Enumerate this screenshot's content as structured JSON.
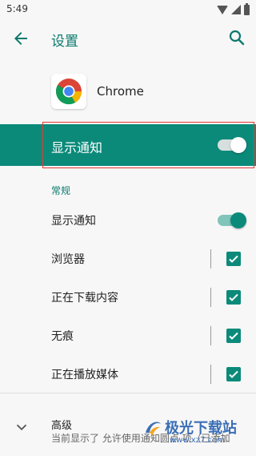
{
  "status_bar": {
    "time": "5:49"
  },
  "header": {
    "title": "设置"
  },
  "app": {
    "name": "Chrome"
  },
  "master_toggle": {
    "label": "显示通知",
    "on": true
  },
  "section": {
    "title": "常规"
  },
  "settings": [
    {
      "label": "显示通知",
      "control": "switch",
      "on": true
    },
    {
      "label": "浏览器",
      "control": "checkbox",
      "checked": true
    },
    {
      "label": "正在下载内容",
      "control": "checkbox",
      "checked": true
    },
    {
      "label": "无痕",
      "control": "checkbox",
      "checked": true
    },
    {
      "label": "正在播放媒体",
      "control": "checkbox",
      "checked": true
    }
  ],
  "advanced": {
    "title": "高级",
    "summary": "当前显示了 允许使用通知圆点 项（已添加"
  },
  "watermark": {
    "text": "极光下载站",
    "url": "www.xz7.com"
  },
  "colors": {
    "accent": "#0b8a7a",
    "highlight": "#e53935"
  }
}
